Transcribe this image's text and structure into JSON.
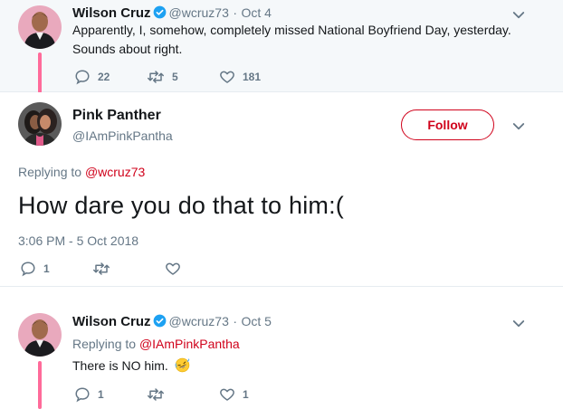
{
  "tweet1": {
    "name": "Wilson Cruz",
    "handle": "@wcruz73",
    "separator": "·",
    "date": "Oct 4",
    "text_line1": "Apparently, I, somehow, completely missed National Boyfriend Day, yesterday.",
    "text_line2": "Sounds about right.",
    "reply_count": "22",
    "retweet_count": "5",
    "like_count": "181"
  },
  "tweet2": {
    "name": "Pink Panther",
    "handle": "@IAmPinkPantha",
    "follow_label": "Follow",
    "replying_prefix": "Replying to ",
    "replying_to": "@wcruz73",
    "text": "How dare you do that to him:(",
    "timestamp": "3:06 PM - 5 Oct 2018",
    "reply_count": "1"
  },
  "tweet3": {
    "name": "Wilson Cruz",
    "handle": "@wcruz73",
    "separator": "·",
    "date": "Oct 5",
    "replying_prefix": "Replying to ",
    "replying_to": "@IAmPinkPantha",
    "text": "There is NO him.",
    "reply_count": "1",
    "like_count": "1"
  },
  "colors": {
    "accent": "#d0021b",
    "thread_line": "#ff6b9a",
    "verified": "#1da1f2",
    "muted": "#657786"
  }
}
